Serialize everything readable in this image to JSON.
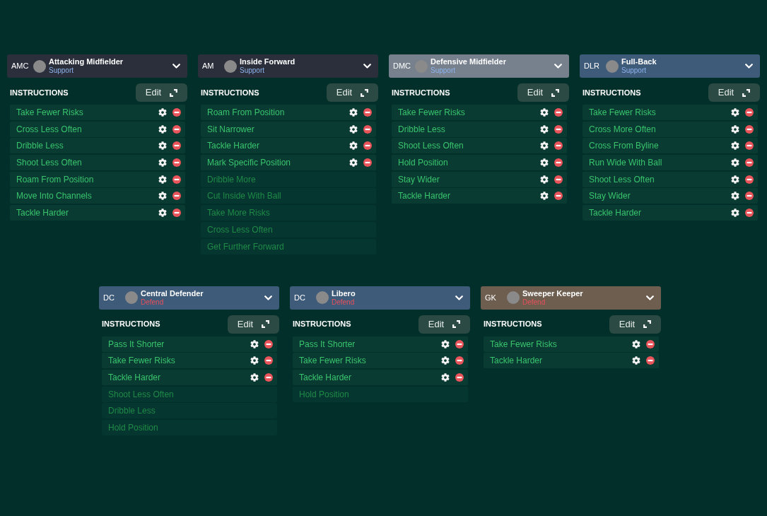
{
  "formation_rows": [
    {
      "cards": [
        {
          "position": "AMC",
          "role": "Attacking Midfielder",
          "duty": {
            "label": "Support",
            "color": "#8db3ec"
          },
          "color": "#2b2f3b",
          "heading": "INSTRUCTIONS",
          "edit_button": "Edit",
          "instructions": [
            {
              "label": "Take Fewer Risks",
              "active": true
            },
            {
              "label": "Cross Less Often",
              "active": true
            },
            {
              "label": "Dribble Less",
              "active": true
            },
            {
              "label": "Shoot Less Often",
              "active": true
            },
            {
              "label": "Roam From Position",
              "active": true
            },
            {
              "label": "Move Into Channels",
              "active": true
            },
            {
              "label": "Tackle Harder",
              "active": true
            }
          ]
        },
        {
          "position": "AM",
          "role": "Inside Forward",
          "duty": {
            "label": "Support",
            "color": "#8db3ec"
          },
          "color": "#2b2f3b",
          "heading": "INSTRUCTIONS",
          "edit_button": "Edit",
          "instructions": [
            {
              "label": "Roam From Position",
              "active": true
            },
            {
              "label": "Sit Narrower",
              "active": true
            },
            {
              "label": "Tackle Harder",
              "active": true
            },
            {
              "label": "Mark Specific Position",
              "active": true
            },
            {
              "label": "Dribble More",
              "active": false
            },
            {
              "label": "Cut Inside With Ball",
              "active": false
            },
            {
              "label": "Take More Risks",
              "active": false
            },
            {
              "label": "Cross Less Often",
              "active": false
            },
            {
              "label": "Get Further Forward",
              "active": false
            }
          ]
        },
        {
          "position": "DMC",
          "role": "Defensive Midfielder",
          "duty": {
            "label": "Support",
            "color": "#8db3ec"
          },
          "color": "#76818d",
          "heading": "INSTRUCTIONS",
          "edit_button": "Edit",
          "instructions": [
            {
              "label": "Take Fewer Risks",
              "active": true
            },
            {
              "label": "Dribble Less",
              "active": true
            },
            {
              "label": "Shoot Less Often",
              "active": true
            },
            {
              "label": "Hold Position",
              "active": true
            },
            {
              "label": "Stay Wider",
              "active": true
            },
            {
              "label": "Tackle Harder",
              "active": true
            }
          ]
        },
        {
          "position": "DLR",
          "role": "Full-Back",
          "duty": {
            "label": "Support",
            "color": "#8db3ec"
          },
          "color": "#3f5b7a",
          "heading": "INSTRUCTIONS",
          "edit_button": "Edit",
          "instructions": [
            {
              "label": "Take Fewer Risks",
              "active": true
            },
            {
              "label": "Cross More Often",
              "active": true
            },
            {
              "label": "Cross From Byline",
              "active": true
            },
            {
              "label": "Run Wide With Ball",
              "active": true
            },
            {
              "label": "Shoot Less Often",
              "active": true
            },
            {
              "label": "Stay Wider",
              "active": true
            },
            {
              "label": "Tackle Harder",
              "active": true
            }
          ]
        }
      ]
    },
    {
      "cards": [
        {
          "position": "DC",
          "role": "Central Defender",
          "duty": {
            "label": "Defend",
            "color": "#e8505a"
          },
          "color": "#3f5b7a",
          "heading": "INSTRUCTIONS",
          "edit_button": "Edit",
          "instructions": [
            {
              "label": "Pass It Shorter",
              "active": true
            },
            {
              "label": "Take Fewer Risks",
              "active": true
            },
            {
              "label": "Tackle Harder",
              "active": true
            },
            {
              "label": "Shoot Less Often",
              "active": false
            },
            {
              "label": "Dribble Less",
              "active": false
            },
            {
              "label": "Hold Position",
              "active": false
            }
          ]
        },
        {
          "position": "DC",
          "role": "Libero",
          "duty": {
            "label": "Defend",
            "color": "#e8505a"
          },
          "color": "#3f5b7a",
          "heading": "INSTRUCTIONS",
          "edit_button": "Edit",
          "instructions": [
            {
              "label": "Pass It Shorter",
              "active": true
            },
            {
              "label": "Take Fewer Risks",
              "active": true
            },
            {
              "label": "Tackle Harder",
              "active": true
            },
            {
              "label": "Hold Position",
              "active": false
            }
          ]
        },
        {
          "position": "GK",
          "role": "Sweeper Keeper",
          "duty": {
            "label": "Defend",
            "color": "#e8505a"
          },
          "color": "#6e5e50",
          "heading": "INSTRUCTIONS",
          "edit_button": "Edit",
          "instructions": [
            {
              "label": "Take Fewer Risks",
              "active": true
            },
            {
              "label": "Tackle Harder",
              "active": true
            }
          ]
        }
      ]
    }
  ]
}
